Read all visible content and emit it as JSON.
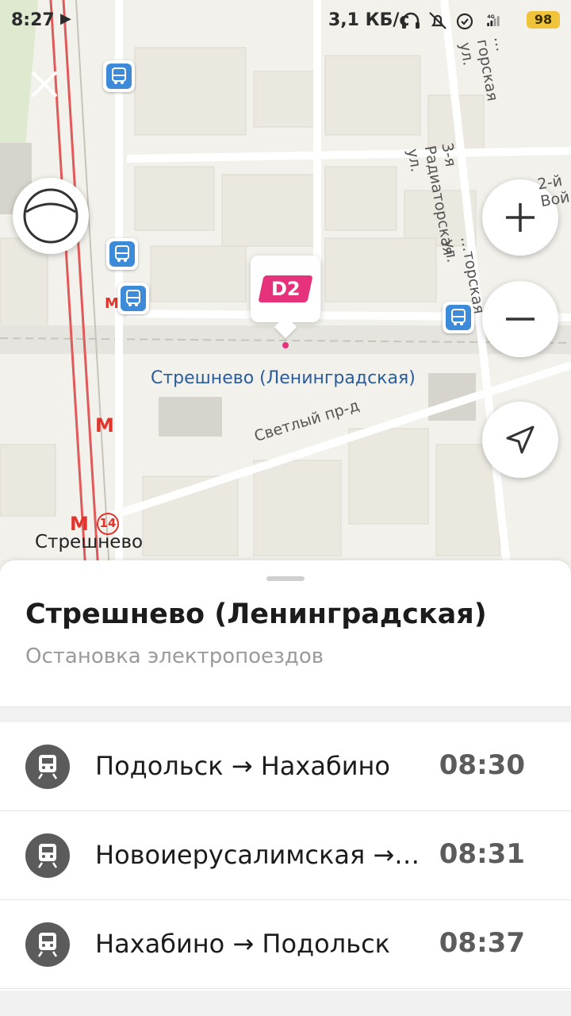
{
  "status_bar": {
    "time": "8:27",
    "speed": "3,1 КБ/с",
    "network": "4G",
    "battery": "98"
  },
  "map": {
    "badge": "D2",
    "station_label": "Стрешнево (Ленинградская)",
    "street_main": "Светлый пр-д",
    "street_vertical": "3-я Радиаторская ул.",
    "street_top": "…горская ул.",
    "street_right": "2-й Вой…",
    "street_vertical2": "…торская ул.",
    "metro_station": "Стрешнево",
    "metro_line": "14",
    "metro_symbol": "M",
    "colors": {
      "brand_d2": "#e6327a",
      "bus_stop": "#3c8ad8",
      "metro": "#e2332b",
      "rail": "#e05a5a"
    }
  },
  "sheet": {
    "title": "Стрешнево (Ленинградская)",
    "subtitle": "Остановка электропоездов",
    "departures": [
      {
        "route": "Подольск → Нахабино",
        "time": "08:30"
      },
      {
        "route": "Новоиерусалимская →…",
        "time": "08:31"
      },
      {
        "route": "Нахабино → Подольск",
        "time": "08:37"
      }
    ]
  }
}
